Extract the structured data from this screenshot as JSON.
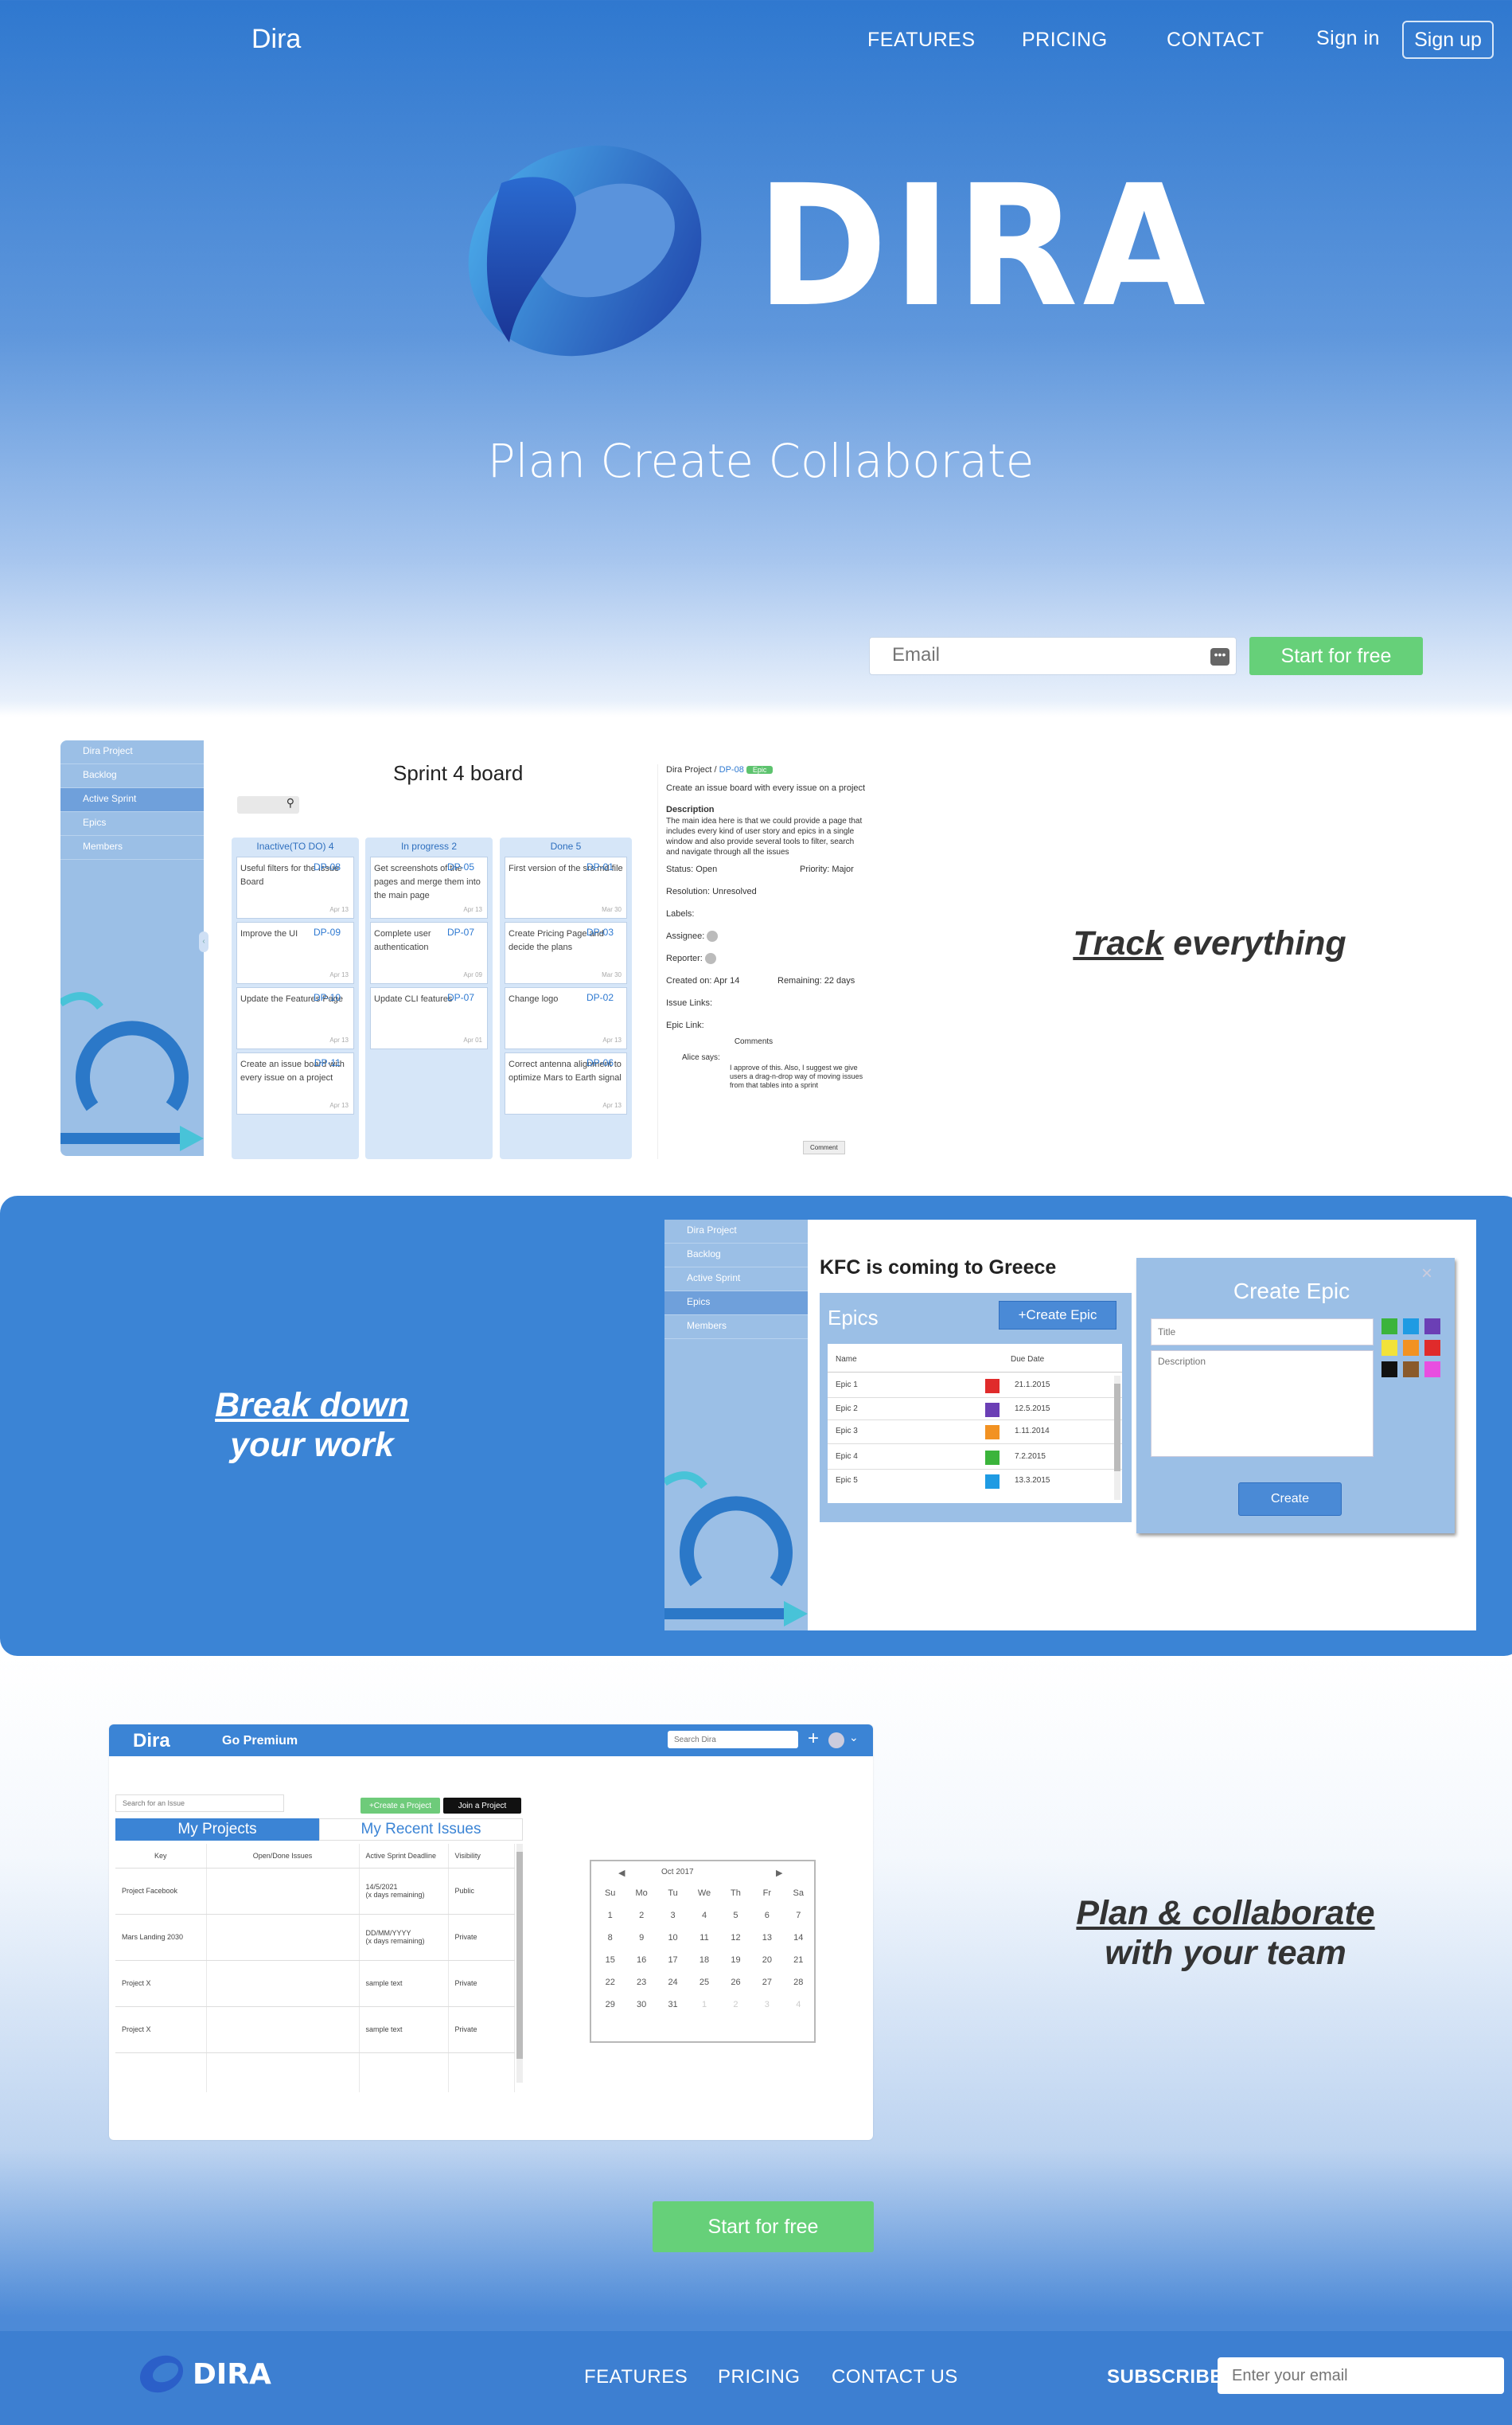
{
  "nav": {
    "brand": "Dira",
    "links": [
      "FEATURES",
      "PRICING",
      "CONTACT"
    ],
    "sign_in": "Sign in",
    "sign_up": "Sign up"
  },
  "hero": {
    "logo_text": "DIRA",
    "tagline": "Plan Create Collaborate",
    "email_placeholder": "Email",
    "cta": "Start for free"
  },
  "features": {
    "track_a": "Track",
    "track_b": " everything",
    "break_a": "Break down",
    "break_b": "your work",
    "plan_a": "Plan & collaborate",
    "plan_b": "with your team"
  },
  "board": {
    "sidebar": [
      "Dira Project",
      "Backlog",
      "Active Sprint",
      "Epics",
      "Members"
    ],
    "title": "Sprint 4 board",
    "columns": [
      {
        "header": "Inactive(TO DO) 4",
        "cards": [
          {
            "text": "Useful filters for the Issue Board",
            "id": "DP-08",
            "date": "Apr 13"
          },
          {
            "text": "Improve the UI",
            "id": "DP-09",
            "date": "Apr 13"
          },
          {
            "text": "Update the Features Page",
            "id": "DP-10",
            "date": "Apr 13"
          },
          {
            "text": "Create an issue board with every issue on a project",
            "id": "DP-11",
            "date": "Apr 13"
          }
        ]
      },
      {
        "header": "In progress 2",
        "cards": [
          {
            "text": "Get screenshots of the pages and merge them into the main page",
            "id": "DP-05",
            "date": "Apr 13"
          },
          {
            "text": "Complete user authentication",
            "id": "DP-07",
            "date": "Apr 09"
          },
          {
            "text": "Update CLI features",
            "id": "DP-07",
            "date": "Apr 01"
          }
        ]
      },
      {
        "header": "Done 5",
        "cards": [
          {
            "text": "First version of the srs.md file",
            "id": "DP-01",
            "date": "Mar 30"
          },
          {
            "text": "Create Pricing Page and decide the plans",
            "id": "DP-03",
            "date": "Mar 30"
          },
          {
            "text": "Change logo",
            "id": "DP-02",
            "date": "Apr 13"
          },
          {
            "text": "Correct antenna alignment to optimize Mars to Earth signal",
            "id": "DP-06",
            "date": "Apr 13"
          }
        ]
      }
    ],
    "detail": {
      "crumb": "Dira Project / ",
      "crumb_id": "DP-08",
      "badge": "Epic",
      "heading": "Create an issue board with every issue on a project",
      "desc_label": "Description",
      "desc": "The main idea here is that we could provide a page that includes every kind of user story and epics in a single window and also provide several tools to filter, search and navigate through all the issues",
      "status": "Status: Open",
      "priority": "Priority: Major",
      "resolution": "Resolution: Unresolved",
      "labels": "Labels:",
      "assignee": "Assignee:",
      "reporter": "Reporter:",
      "created": "Created on: Apr 14",
      "remaining": "Remaining: 22 days",
      "issue_links": "Issue Links:",
      "epic_link": "Epic Link:",
      "comments": "Comments",
      "comment_author": "Alice says:",
      "comment_text": "I approve of this. Also, I suggest we give users a drag-n-drop way of moving issues from that tables into a sprint",
      "comment_btn": "Comment"
    }
  },
  "epics_screen": {
    "sidebar": [
      "Dira Project",
      "Backlog",
      "Active Sprint",
      "Epics",
      "Members"
    ],
    "project_title": "KFC is coming to Greece",
    "panel_title": "Epics",
    "create_btn": "+Create Epic",
    "col_name": "Name",
    "col_due": "Due Date",
    "epics": [
      {
        "name": "Epic 1",
        "color": "#e02b2b",
        "due": "21.1.2015"
      },
      {
        "name": "Epic 2",
        "color": "#6b3fb5",
        "due": "12.5.2015"
      },
      {
        "name": "Epic 3",
        "color": "#f29222",
        "due": "1.11.2014"
      },
      {
        "name": "Epic 4",
        "color": "#3bb43b",
        "due": "7.2.2015"
      },
      {
        "name": "Epic 5",
        "color": "#1f9be3",
        "due": "13.3.2015"
      }
    ],
    "dialog_title": "Create Epic",
    "title_placeholder": "Title",
    "desc_placeholder": "Description",
    "swatches": [
      "#3bb43b",
      "#1f9be3",
      "#6b3fb5",
      "#f2e23a",
      "#f29222",
      "#e02b2b",
      "#111111",
      "#8a5a2b",
      "#e84ee0"
    ],
    "dialog_btn": "Create"
  },
  "projects_screen": {
    "brand": "Dira",
    "premium": "Go Premium",
    "search_placeholder": "Search Dira",
    "issue_search_placeholder": "Search for an Issue",
    "create_project": "+Create a Project",
    "join_project": "Join a Project",
    "tab_projects": "My Projects",
    "tab_issues": "My Recent Issues",
    "headers": [
      "Key",
      "Open/Done Issues",
      "Active Sprint Deadline",
      "Visibility"
    ],
    "rows": [
      [
        "Project Facebook",
        "",
        "14/5/2021\n(x days remaining)",
        "Public"
      ],
      [
        "Mars Landing 2030",
        "",
        "DD/MM/YYYY\n(x days remaining)",
        "Private"
      ],
      [
        "Project X",
        "",
        "sample text",
        "Private"
      ],
      [
        "Project X",
        "",
        "sample text",
        "Private"
      ]
    ],
    "calendar": {
      "month": "Oct 2017",
      "days": [
        "Su",
        "Mo",
        "Tu",
        "We",
        "Th",
        "Fr",
        "Sa"
      ],
      "weeks": [
        [
          "1",
          "2",
          "3",
          "4",
          "5",
          "6",
          "7"
        ],
        [
          "8",
          "9",
          "10",
          "11",
          "12",
          "13",
          "14"
        ],
        [
          "15",
          "16",
          "17",
          "18",
          "19",
          "20",
          "21"
        ],
        [
          "22",
          "23",
          "24",
          "25",
          "26",
          "27",
          "28"
        ],
        [
          "29",
          "30",
          "31",
          "1",
          "2",
          "3",
          "4"
        ]
      ]
    }
  },
  "bottom_cta": "Start for free",
  "footer": {
    "logo_text": "DIRA",
    "links": [
      "FEATURES",
      "PRICING",
      "CONTACT US"
    ],
    "subscribe": "SUBSCRIBE",
    "email_placeholder": "Enter your email"
  }
}
